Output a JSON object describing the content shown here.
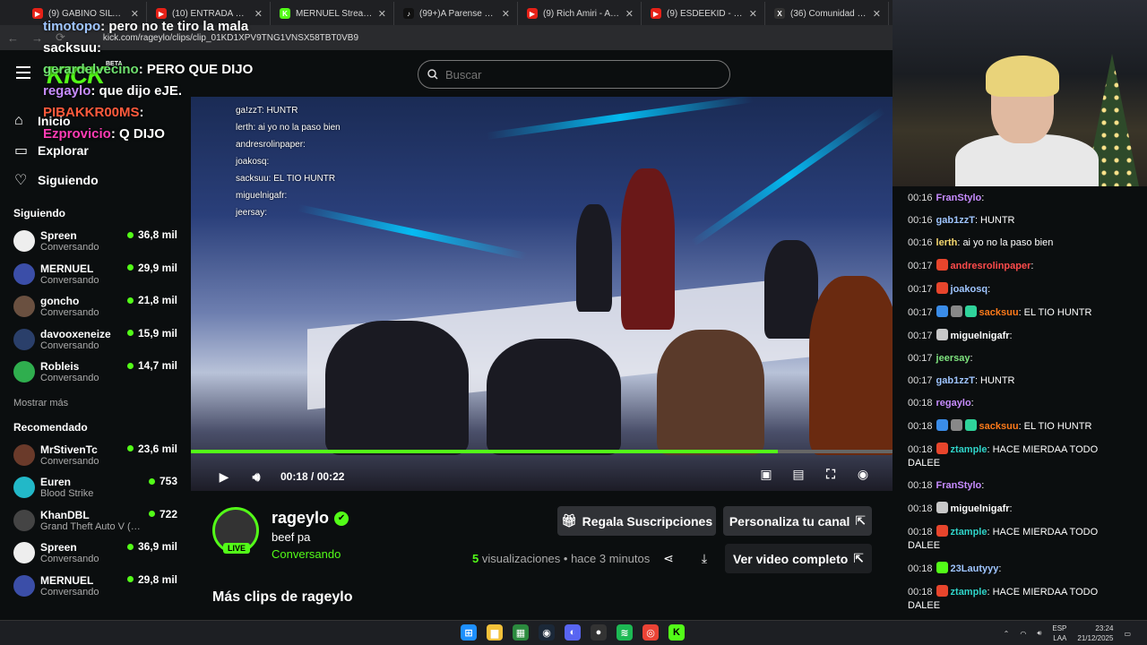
{
  "browser": {
    "tabs": [
      {
        "title": "(9) GABINO SILVA PELEA",
        "color": "#e62117",
        "glyph": "▶"
      },
      {
        "title": "(10) ENTRADA GABINO S",
        "color": "#e62117",
        "glyph": "▶"
      },
      {
        "title": "MERNUEL Stream - Watch",
        "color": "#53fc18",
        "glyph": "K"
      },
      {
        "title": "(99+)A Parense de Manos",
        "color": "#111111",
        "glyph": "♪"
      },
      {
        "title": "(9) Rich Amiri - AMIRI TR",
        "color": "#e62117",
        "glyph": "▶"
      },
      {
        "title": "(9) ESDEEKID - 4 RAWS",
        "color": "#e62117",
        "glyph": "▶"
      },
      {
        "title": "(36) Comunidad JOSEO",
        "color": "#333333",
        "glyph": "X"
      }
    ],
    "url": "kick.com/rageylo/clips/clip_01KD1XPV9TNG1VNSX58TBT0VB9"
  },
  "overlay_chat": [
    {
      "user": "timotopo",
      "text": ": pero no te tiro la mala",
      "color": "#9fc5ff"
    },
    {
      "user": "sacksuu",
      "text": ":",
      "color": "#ffffff"
    },
    {
      "user": "gerardelvecino",
      "text": ": PERO QUE DIJO",
      "color": "#6ee06e"
    },
    {
      "user": "regaylo",
      "text": ": que dijo eJE.",
      "color": "#c78cff"
    },
    {
      "user": "PIBAKKR00MS",
      "text": ":",
      "color": "#ff5a3c"
    },
    {
      "user": "Ezprovicio",
      "text": ": Q DIJO",
      "color": "#ff3cb4"
    }
  ],
  "header": {
    "search_placeholder": "Buscar",
    "beta": "BETA"
  },
  "sidebar": {
    "nav": [
      {
        "label": "Inicio",
        "icon": "home-icon"
      },
      {
        "label": "Explorar",
        "icon": "browse-icon"
      },
      {
        "label": "Siguiendo",
        "icon": "heart-icon"
      }
    ],
    "following_title": "Siguiendo",
    "following": [
      {
        "name": "Spreen",
        "category": "Conversando",
        "viewers": "36,8 mil",
        "color": "#eeeeee"
      },
      {
        "name": "MERNUEL",
        "category": "Conversando",
        "viewers": "29,9 mil",
        "color": "#3b4ea8"
      },
      {
        "name": "goncho",
        "category": "Conversando",
        "viewers": "21,8 mil",
        "color": "#6a5040"
      },
      {
        "name": "davooxeneize",
        "category": "Conversando",
        "viewers": "15,9 mil",
        "color": "#2a3f6a"
      },
      {
        "name": "Robleis",
        "category": "Conversando",
        "viewers": "14,7 mil",
        "color": "#2fae4e"
      }
    ],
    "show_more": "Mostrar más",
    "recommended_title": "Recomendado",
    "recommended": [
      {
        "name": "MrStivenTc",
        "category": "Conversando",
        "viewers": "23,6 mil",
        "color": "#6a3a2a"
      },
      {
        "name": "Euren",
        "category": "Blood Strike",
        "viewers": "753",
        "color": "#22b8c8"
      },
      {
        "name": "KhanDBL",
        "category": "Grand Theft Auto V (G...",
        "viewers": "722",
        "color": "#444444"
      },
      {
        "name": "Spreen",
        "category": "Conversando",
        "viewers": "36,9 mil",
        "color": "#eeeeee"
      },
      {
        "name": "MERNUEL",
        "category": "Conversando",
        "viewers": "29,8 mil",
        "color": "#3b4ea8"
      }
    ]
  },
  "video": {
    "current_time": "00:18",
    "duration": "00:22",
    "progress": 0.836,
    "overlay_lines": [
      "ga!zzT: HUNTR",
      "lerth: ai yo no la paso bien",
      "andresrolinpaper:",
      "joakosq:",
      "sacksuu: EL TIO HUNTR",
      "miguelnigafr:",
      "jeersay:"
    ]
  },
  "clip": {
    "channel": "rageylo",
    "title": "beef pa",
    "category": "Conversando",
    "live_label": "LIVE",
    "views_count": "5",
    "views_label": "visualizaciones",
    "age": "hace 3 minutos",
    "gift_button": "Regala Suscripciones",
    "customize_button": "Personaliza tu canal",
    "full_video_button": "Ver video completo",
    "more_clips": "Más clips de rageylo"
  },
  "chat": [
    {
      "time": "00:16",
      "user": "FranStylo",
      "text": "",
      "color": "#c78cff",
      "badges": []
    },
    {
      "time": "00:16",
      "user": "gab1zzT",
      "text": "HUNTR",
      "color": "#9fc5ff",
      "badges": []
    },
    {
      "time": "00:16",
      "user": "lerth",
      "text": "ai yo no la paso bien",
      "color": "#f5d76e",
      "badges": []
    },
    {
      "time": "00:17",
      "user": "andresrolinpaper",
      "text": "",
      "color": "#ff4b4b",
      "badges": [
        "#e8452c"
      ]
    },
    {
      "time": "00:17",
      "user": "joakosq",
      "text": "",
      "color": "#9fc5ff",
      "badges": [
        "#e8452c"
      ]
    },
    {
      "time": "00:17",
      "user": "sacksuu",
      "text": "EL TIO HUNTR",
      "color": "#ff7a1a",
      "badges": [
        "#3a8ce8",
        "#888888",
        "#2fd39a"
      ]
    },
    {
      "time": "00:17",
      "user": "miguelnigafr",
      "text": "",
      "color": "#ffffff",
      "badges": [
        "#c8c8c8"
      ]
    },
    {
      "time": "00:17",
      "user": "jeersay",
      "text": "",
      "color": "#7ee37e",
      "badges": []
    },
    {
      "time": "00:17",
      "user": "gab1zzT",
      "text": "HUNTR",
      "color": "#9fc5ff",
      "badges": []
    },
    {
      "time": "00:18",
      "user": "regaylo",
      "text": "",
      "color": "#c78cff",
      "badges": []
    },
    {
      "time": "00:18",
      "user": "sacksuu",
      "text": "EL TIO HUNTR",
      "color": "#ff7a1a",
      "badges": [
        "#3a8ce8",
        "#888888",
        "#2fd39a"
      ]
    },
    {
      "time": "00:18",
      "user": "ztample",
      "text": "HACE MIERDAA TODO DALEE",
      "color": "#2fd3c8",
      "badges": [
        "#e8452c"
      ]
    },
    {
      "time": "00:18",
      "user": "FranStylo",
      "text": "",
      "color": "#c78cff",
      "badges": []
    },
    {
      "time": "00:18",
      "user": "miguelnigafr",
      "text": "",
      "color": "#ffffff",
      "badges": [
        "#c8c8c8"
      ]
    },
    {
      "time": "00:18",
      "user": "ztample",
      "text": "HACE MIERDAA TODO DALEE",
      "color": "#2fd3c8",
      "badges": [
        "#e8452c"
      ]
    },
    {
      "time": "00:18",
      "user": "23Lautyyy",
      "text": "",
      "color": "#9fc5ff",
      "badges": [
        "#53fc18"
      ]
    },
    {
      "time": "00:18",
      "user": "ztample",
      "text": "HACE MIERDAA TODO DALEE",
      "color": "#2fd3c8",
      "badges": [
        "#e8452c"
      ]
    }
  ],
  "taskbar": {
    "lang1": "ESP",
    "lang2": "LAA",
    "time": "23:24",
    "date": "21/12/2025",
    "apps": [
      {
        "name": "windows-start-icon",
        "color": "#1e90ff",
        "glyph": "⊞"
      },
      {
        "name": "file-explorer-icon",
        "color": "#f3c13a",
        "glyph": "▆"
      },
      {
        "name": "app-icon",
        "color": "#2b8a3e",
        "glyph": "▦"
      },
      {
        "name": "steam-icon",
        "color": "#1b2838",
        "glyph": "◉"
      },
      {
        "name": "discord-icon",
        "color": "#5865f2",
        "glyph": "◐"
      },
      {
        "name": "github-icon",
        "color": "#333333",
        "glyph": "●"
      },
      {
        "name": "spotify-icon",
        "color": "#1db954",
        "glyph": "≋"
      },
      {
        "name": "chrome-icon",
        "color": "#ea4335",
        "glyph": "◎"
      },
      {
        "name": "kick-icon",
        "color": "#53fc18",
        "glyph": "K"
      }
    ]
  }
}
